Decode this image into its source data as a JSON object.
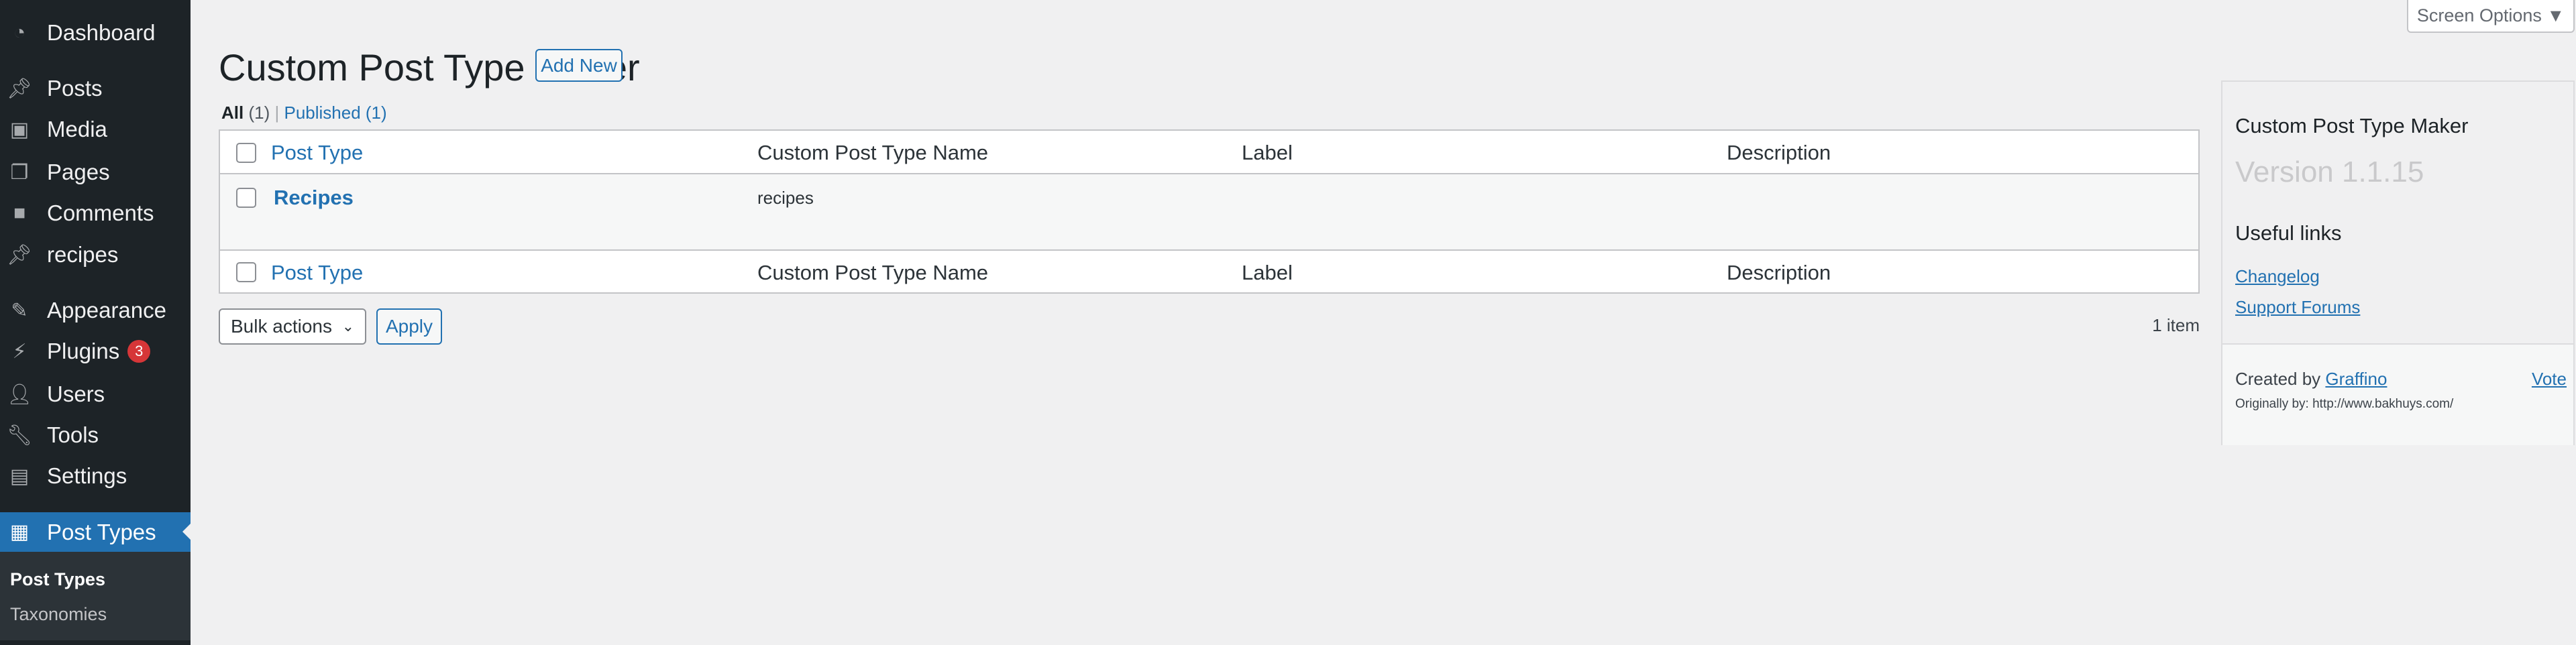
{
  "sidebar": {
    "items": [
      {
        "label": "Dashboard",
        "icon": "dashboard-icon"
      },
      {
        "label": "Posts",
        "icon": "pin-icon"
      },
      {
        "label": "Media",
        "icon": "media-icon"
      },
      {
        "label": "Pages",
        "icon": "pages-icon"
      },
      {
        "label": "Comments",
        "icon": "comment-icon"
      },
      {
        "label": "recipes",
        "icon": "pin-icon"
      },
      {
        "label": "Appearance",
        "icon": "brush-icon"
      },
      {
        "label": "Plugins",
        "icon": "plugin-icon",
        "badge": "3"
      },
      {
        "label": "Users",
        "icon": "user-icon"
      },
      {
        "label": "Tools",
        "icon": "wrench-icon"
      },
      {
        "label": "Settings",
        "icon": "settings-icon"
      }
    ],
    "active": {
      "label": "Post Types",
      "icon": "grid-icon"
    },
    "submenu": [
      "Post Types",
      "Taxonomies"
    ]
  },
  "header": {
    "screen_options": "Screen Options ▼",
    "title": "Custom Post Type Maker",
    "add_new": "Add New"
  },
  "filters": {
    "all": "All",
    "all_count": "(1)",
    "sep": "|",
    "published": "Published (1)"
  },
  "table": {
    "columns": [
      "Post Type",
      "Custom Post Type Name",
      "Label",
      "Description"
    ],
    "rows": [
      {
        "post_type": "Recipes",
        "name": "recipes",
        "label": "",
        "description": ""
      }
    ]
  },
  "bulk": {
    "selected": "Bulk actions",
    "apply": "Apply",
    "count": "1 item"
  },
  "panel": {
    "title": "Custom Post Type Maker",
    "version": "Version 1.1.15",
    "useful": "Useful links",
    "links": [
      "Changelog",
      "Support Forums"
    ],
    "created_by": "Created by",
    "author": "Graffino",
    "vote": "Vote",
    "original": "Originally by: http://www.bakhuys.com/"
  },
  "colors": {
    "accent": "#2271b1",
    "sidebar": "#1d2327",
    "badge": "#d63638"
  }
}
